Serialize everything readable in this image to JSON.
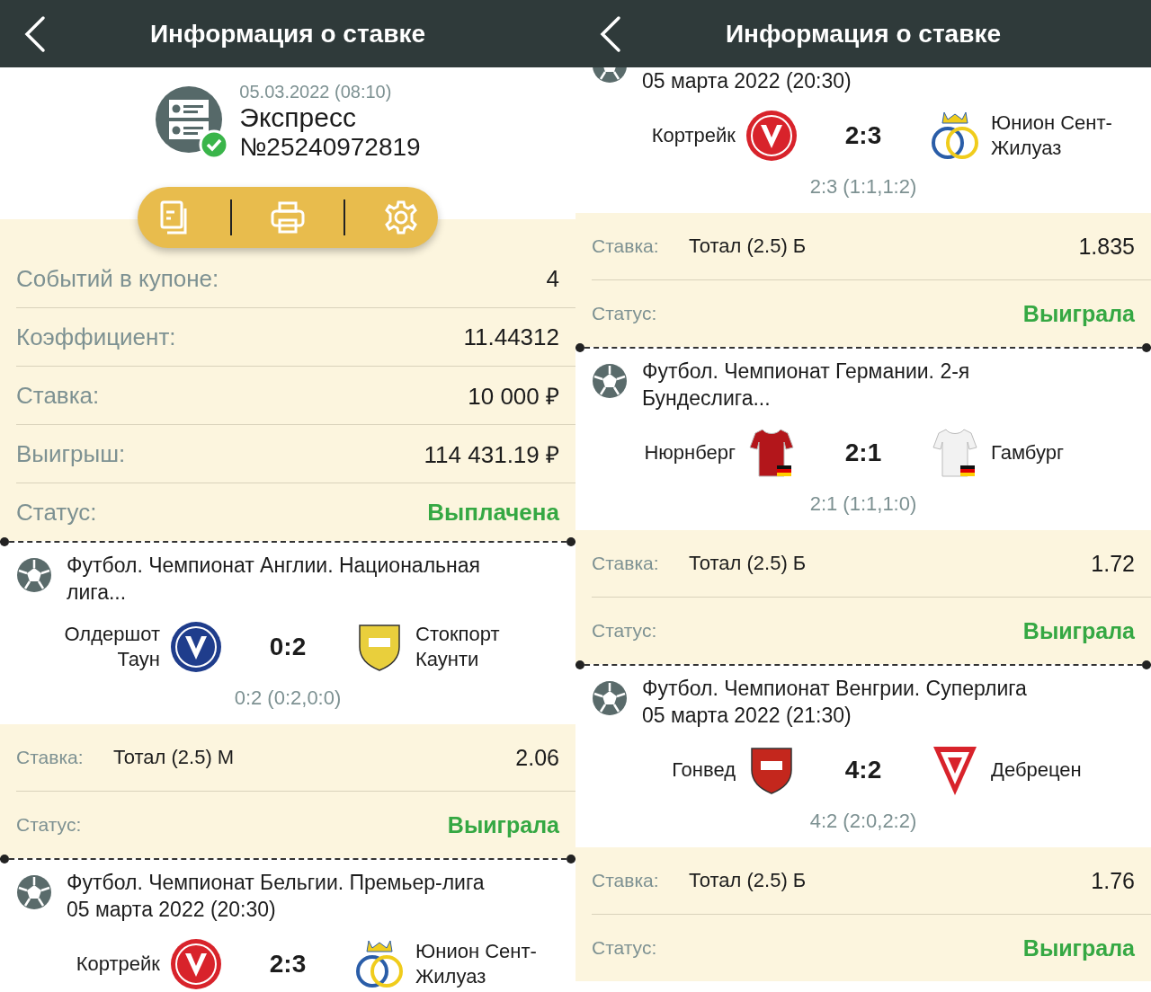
{
  "screens": [
    {
      "title": "Информация о ставке",
      "ticket": {
        "date": "05.03.2022 (08:10)",
        "type": "Экспресс",
        "number": "№25240972819"
      },
      "summary": [
        {
          "label": "Событий в купоне:",
          "value": "4",
          "kind": "plain"
        },
        {
          "label": "Коэффициент:",
          "value": "11.44312",
          "kind": "plain"
        },
        {
          "label": "Ставка:",
          "value": "10 000 ₽",
          "kind": "plain"
        },
        {
          "label": "Выигрыш:",
          "value": "114 431.19 ₽",
          "kind": "plain"
        },
        {
          "label": "Статус:",
          "value": "Выплачена",
          "kind": "status"
        }
      ],
      "events": [
        {
          "league": "Футбол. Чемпионат Англии. Национальная лига...",
          "home": "Олдершот Таун",
          "home_logo": {
            "kind": "crest",
            "color": "#1f3d8c"
          },
          "score": "0:2",
          "away": "Стокпорт Каунти",
          "away_logo": {
            "kind": "shield",
            "color": "#e9cf3c"
          },
          "detail": "0:2 (0:2,0:0)",
          "bet": {
            "label": "Ставка:",
            "market": "Тотал (2.5) М",
            "odds": "2.06"
          },
          "status": {
            "label": "Статус:",
            "value": "Выиграла"
          }
        },
        {
          "league": "Футбол. Чемпионат Бельгии. Премьер-лига",
          "date": "05 марта 2022 (20:30)",
          "home": "Кортрейк",
          "home_logo": {
            "kind": "crest",
            "color": "#d8232b"
          },
          "score": "2:3",
          "away": "Юнион Сент-Жилуаз",
          "away_logo": {
            "kind": "rings",
            "color": "#f0cc1c"
          }
        }
      ]
    },
    {
      "title": "Информация о ставке",
      "events": [
        {
          "date": "05 марта 2022 (20:30)",
          "home": "Кортрейк",
          "home_logo": {
            "kind": "crest",
            "color": "#d8232b"
          },
          "score": "2:3",
          "away": "Юнион Сент-Жилуаз",
          "away_logo": {
            "kind": "rings",
            "color": "#f0cc1c"
          },
          "detail": "2:3 (1:1,1:2)",
          "bet": {
            "label": "Ставка:",
            "market": "Тотал (2.5) Б",
            "odds": "1.835"
          },
          "status": {
            "label": "Статус:",
            "value": "Выиграла"
          }
        },
        {
          "league": "Футбол. Чемпионат Германии. 2-я Бундеслига...",
          "home": "Нюрнберг",
          "home_logo": {
            "kind": "shirt",
            "color": "#b3161b"
          },
          "score": "2:1",
          "away": "Гамбург",
          "away_logo": {
            "kind": "shirt",
            "color": "#f2f2f2"
          },
          "detail": "2:1 (1:1,1:0)",
          "bet": {
            "label": "Ставка:",
            "market": "Тотал (2.5) Б",
            "odds": "1.72"
          },
          "status": {
            "label": "Статус:",
            "value": "Выиграла"
          }
        },
        {
          "league": "Футбол. Чемпионат Венгрии. Суперлига",
          "date": "05 марта 2022 (21:30)",
          "home": "Гонвед",
          "home_logo": {
            "kind": "shield",
            "color": "#c4271d"
          },
          "score": "4:2",
          "away": "Дебрецен",
          "away_logo": {
            "kind": "pennant",
            "color": "#d8232b"
          },
          "detail": "4:2 (2:0,2:2)",
          "bet": {
            "label": "Ставка:",
            "market": "Тотал (2.5) Б",
            "odds": "1.76"
          },
          "status": {
            "label": "Статус:",
            "value": "Выиграла"
          }
        }
      ]
    }
  ]
}
